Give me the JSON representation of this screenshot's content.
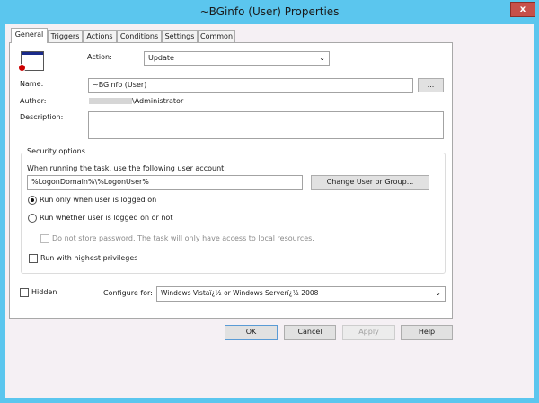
{
  "window": {
    "title": "~BGinfo (User) Properties",
    "close": "x"
  },
  "tabs": [
    "General",
    "Triggers",
    "Actions",
    "Conditions",
    "Settings",
    "Common"
  ],
  "general": {
    "action_label": "Action:",
    "action_value": "Update",
    "name_label": "Name:",
    "name_value": "~BGinfo (User)",
    "browse": "...",
    "author_label": "Author:",
    "author_value": "\\Administrator",
    "description_label": "Description:",
    "description_value": "",
    "security": {
      "title": "Security options",
      "account_prompt": "When running the task, use the following user account:",
      "account_value": "%LogonDomain%\\%LogonUser%",
      "change_button": "Change User or Group...",
      "radio_logged_on": "Run only when user is logged on",
      "radio_whether": "Run whether user is logged on or not",
      "no_store": "Do not store password.  The task will only have access to local resources.",
      "highest": "Run with highest privileges"
    },
    "hidden_label": "Hidden",
    "configure_label": "Configure for:",
    "configure_value": "Windows Vistaï¿½ or Windows Serverï¿½ 2008"
  },
  "buttons": {
    "ok": "OK",
    "cancel": "Cancel",
    "apply": "Apply",
    "help": "Help"
  }
}
